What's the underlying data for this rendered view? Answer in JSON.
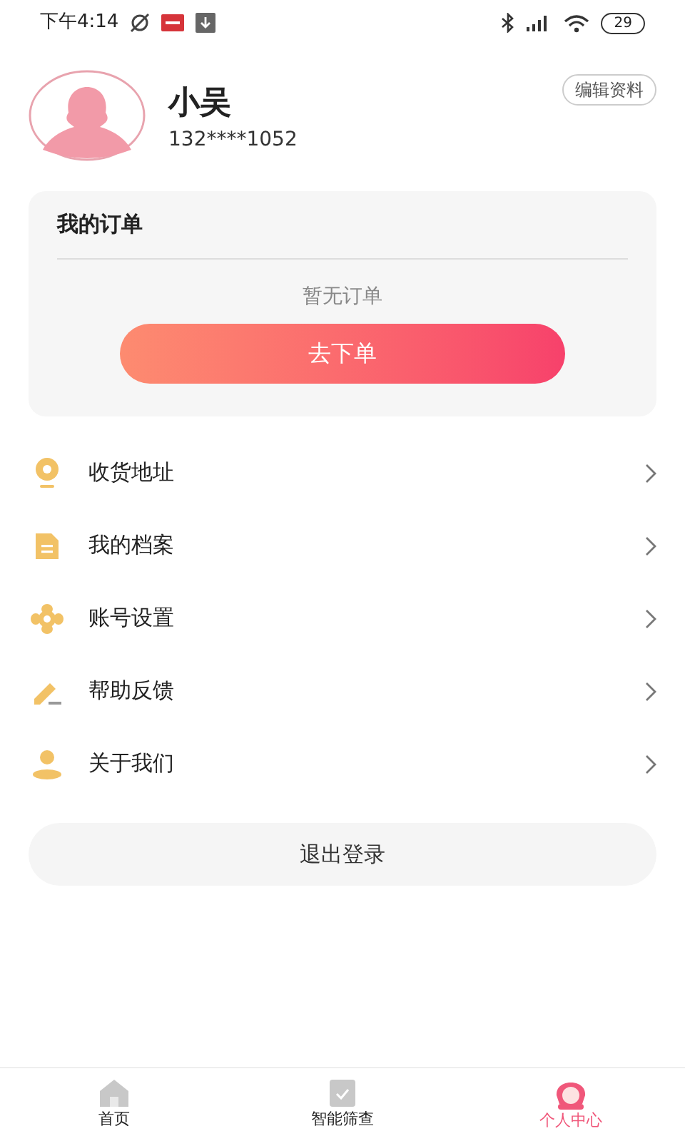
{
  "status_bar": {
    "time": "下午4:14",
    "battery": "29"
  },
  "profile": {
    "name": "小吴",
    "phone": "132****1052",
    "edit_button": "编辑资料"
  },
  "orders": {
    "title": "我的订单",
    "empty_text": "暂无订单",
    "order_button": "去下单"
  },
  "menu": [
    {
      "kind": "location",
      "label": "收货地址"
    },
    {
      "kind": "document",
      "label": "我的档案"
    },
    {
      "kind": "settings",
      "label": "账号设置"
    },
    {
      "kind": "feedback",
      "label": "帮助反馈"
    },
    {
      "kind": "person",
      "label": "关于我们"
    }
  ],
  "logout_button": "退出登录",
  "tab_bar": [
    {
      "kind": "home",
      "label": "首页",
      "selected": false
    },
    {
      "kind": "screening",
      "label": "智能筛查",
      "selected": false
    },
    {
      "kind": "profile",
      "label": "个人中心",
      "selected": true
    }
  ]
}
